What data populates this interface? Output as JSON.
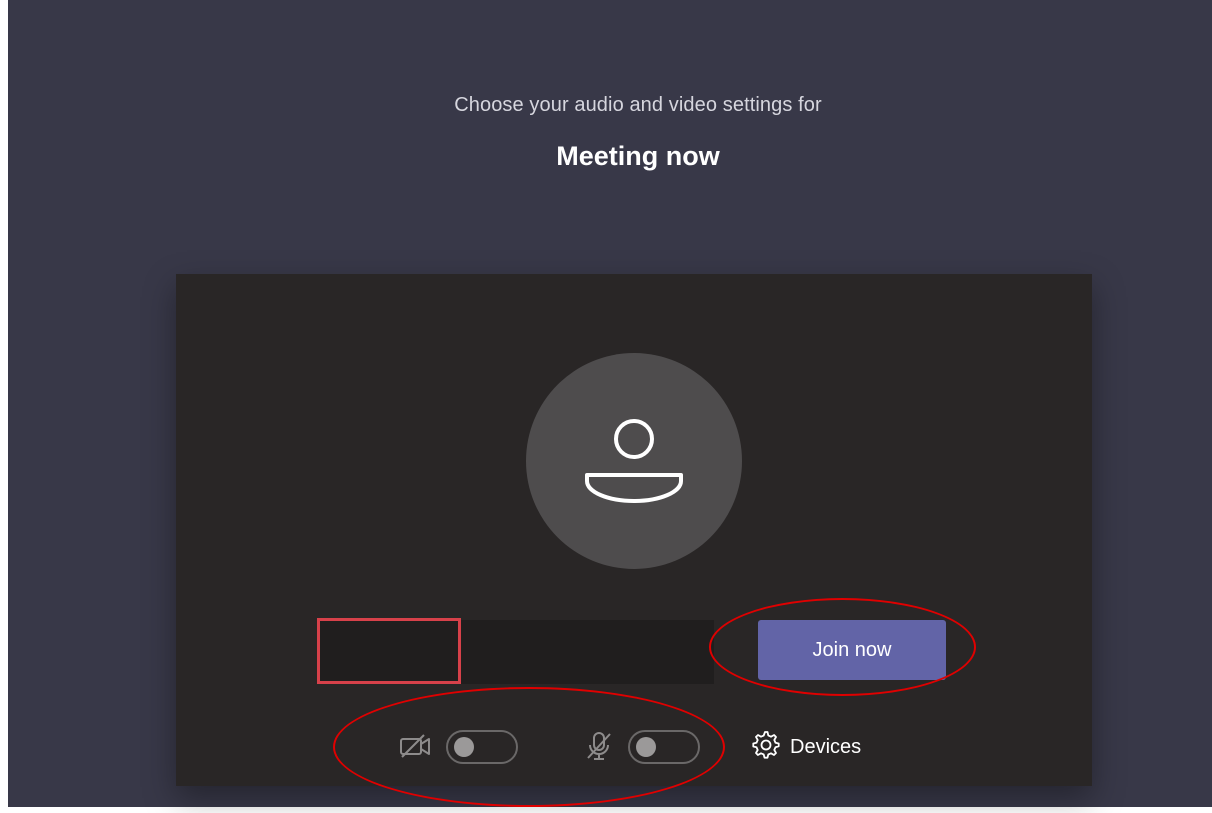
{
  "header": {
    "prompt": "Choose your audio and video settings for",
    "meeting_title": "Meeting now"
  },
  "preview": {
    "avatar_icon": "person-icon"
  },
  "join": {
    "name_input_value": "",
    "join_label": "Join now"
  },
  "controls": {
    "camera": {
      "icon": "camera-off-icon",
      "state": "off"
    },
    "microphone": {
      "icon": "mic-off-icon",
      "state": "off"
    },
    "devices": {
      "icon": "gear-icon",
      "label": "Devices"
    }
  },
  "annotations": {
    "color": "#e00000",
    "box_color": "#d7414a"
  },
  "colors": {
    "background": "#383848",
    "card": "#292626",
    "accent": "#6264a7"
  }
}
